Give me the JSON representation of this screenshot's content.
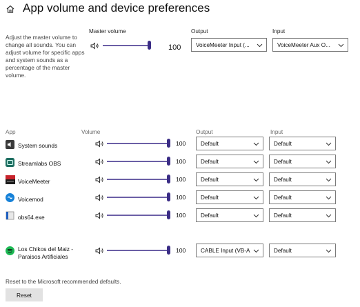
{
  "page": {
    "title": "App volume and device preferences",
    "description": "Adjust the master volume to change all sounds. You can adjust volume for specific apps and system sounds as a percentage of the master volume."
  },
  "master": {
    "label": "Master volume",
    "value": "100",
    "level": 1.0,
    "output_label": "Output",
    "output_value": "VoiceMeeter Input (...",
    "input_label": "Input",
    "input_value": "VoiceMeeter Aux O..."
  },
  "columns": {
    "app": "App",
    "volume": "Volume",
    "output": "Output",
    "input": "Input"
  },
  "apps": [
    {
      "name": "System sounds",
      "volume": "100",
      "level": 1.0,
      "output": "Default",
      "input": "Default",
      "icon": "system-sounds-icon"
    },
    {
      "name": "Streamlabs OBS",
      "volume": "100",
      "level": 1.0,
      "output": "Default",
      "input": "Default",
      "icon": "streamlabs-obs-icon"
    },
    {
      "name": "VoiceMeeter",
      "volume": "100",
      "level": 1.0,
      "output": "Default",
      "input": "Default",
      "icon": "voicemeeter-icon"
    },
    {
      "name": "Voicemod",
      "volume": "100",
      "level": 1.0,
      "output": "Default",
      "input": "Default",
      "icon": "voicemod-icon"
    },
    {
      "name": "obs64.exe",
      "volume": "100",
      "level": 1.0,
      "output": "Default",
      "input": "Default",
      "icon": "obs64-icon"
    },
    {
      "name": "Los Chikos del Maiz -",
      "name2": "Paraisos Artificiales",
      "volume": "100",
      "level": 1.0,
      "output": "CABLE Input (VB-A",
      "input": "Default",
      "icon": "spotify-icon"
    }
  ],
  "reset": {
    "description": "Reset to the Microsoft recommended defaults.",
    "button": "Reset"
  },
  "colors": {
    "slider_track": "#6b5fa6",
    "slider_thumb": "#3b2d86",
    "spotify": "#1db954"
  }
}
